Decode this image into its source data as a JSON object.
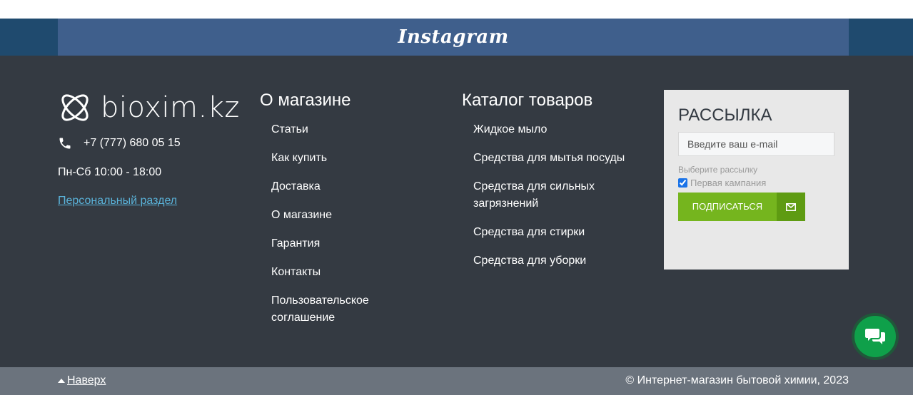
{
  "instagram": {
    "label": "Instagram"
  },
  "brand": {
    "name": "bioxim.kz"
  },
  "contact": {
    "phone": "+7 (777) 680 05 15",
    "hours": "Пн-Сб 10:00 - 18:00",
    "personal_link": "Персональный раздел"
  },
  "about_menu": {
    "title": "О магазине",
    "items": [
      {
        "label": "Статьи"
      },
      {
        "label": "Как купить"
      },
      {
        "label": "Доставка"
      },
      {
        "label": "О магазине"
      },
      {
        "label": "Гарантия"
      },
      {
        "label": "Контакты"
      },
      {
        "label": "Пользовательское соглашение"
      }
    ]
  },
  "catalog_menu": {
    "title": "Каталог товаров",
    "items": [
      {
        "label": "Жидкое мыло"
      },
      {
        "label": "Средства для мытья посуды"
      },
      {
        "label": "Средства для сильных загрязнений"
      },
      {
        "label": "Средства для стирки"
      },
      {
        "label": "Средства для уборки"
      }
    ]
  },
  "newsletter": {
    "title": "РАССЫЛКА",
    "email_placeholder": "Введите ваш e-mail",
    "email_value": "",
    "select_label": "Выберите рассылку",
    "campaign_label": "Первая кампания",
    "campaign_checked": true,
    "subscribe_label": "ПОДПИСАТЬСЯ",
    "button_icon": "envelope-icon"
  },
  "chat": {
    "icon": "chat-bubbles-icon"
  },
  "bottom": {
    "to_top": "Наверх",
    "copyright": "© Интернет-магазин бытовой химии, 2023"
  },
  "colors": {
    "footer_bg": "#343a42",
    "instagram_bar": "#3f5f8c",
    "accent_green": "#75b51e",
    "link_blue": "#5ab3da",
    "chat_green": "#0fa04a",
    "bottom_bar": "#6b737d"
  }
}
